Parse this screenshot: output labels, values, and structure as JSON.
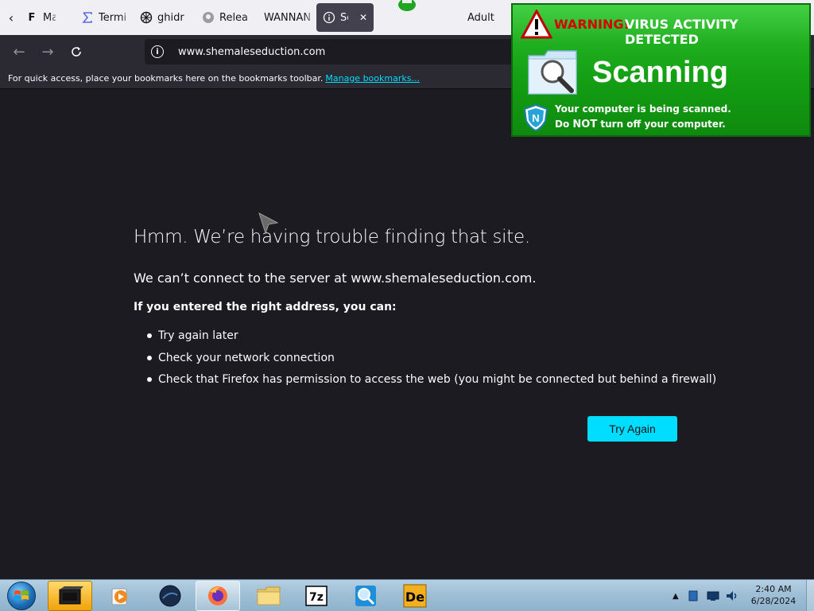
{
  "browser": {
    "tabs": [
      {
        "label": "Manu",
        "icon": "F"
      },
      {
        "label": "Termi",
        "icon": "sigma-icon"
      },
      {
        "label": "ghidr",
        "icon": "ghidra-icon"
      },
      {
        "label": "Relea",
        "icon": "github-icon"
      },
      {
        "label": "WANNAN",
        "icon": ""
      },
      {
        "label": "Se",
        "icon": "info-icon",
        "active": true
      },
      {
        "label": "Adult",
        "icon": "adult-icon"
      },
      {
        "label": "",
        "icon": "globe-icon"
      }
    ],
    "url": "www.shemaleseduction.com",
    "bookmarks_text": "For quick access, place your bookmarks here on the bookmarks toolbar.",
    "bookmarks_link": "Manage bookmarks..."
  },
  "error": {
    "title": "Hmm. We’re having trouble finding that site.",
    "lead": "We can’t connect to the server at www.shemaleseduction.com.",
    "subheading": "If you entered the right address, you can:",
    "suggestions": [
      "Try again later",
      "Check your network connection",
      "Check that Firefox has permission to access the web (you might be connected but behind a firewall)"
    ],
    "button": "Try Again"
  },
  "popup": {
    "warning_red": "WARNING!",
    "warning_white": "VIRUS ACTIVITY DETECTED",
    "scanning": "Scanning",
    "line1": "Your computer is being scanned.",
    "line2_pre": "Do ",
    "line2_strong": "NOT",
    "line2_post": " turn off your computer."
  },
  "taskbar": {
    "time": "2:40 AM",
    "date": "6/28/2024"
  },
  "colors": {
    "accent": "#00ddff",
    "page_bg": "#1c1b22",
    "popup_green": "#14a014"
  }
}
